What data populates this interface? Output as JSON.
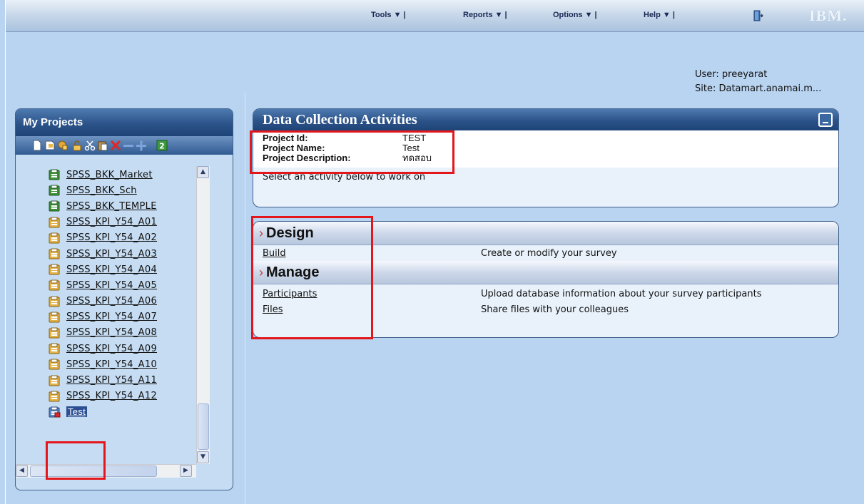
{
  "topbar": {
    "menus": [
      "Tools ▼ |",
      "Reports ▼ |",
      "Options ▼ |",
      "Help ▼ |"
    ],
    "brand": "IBM."
  },
  "user": {
    "user_line": "User: preeyarat",
    "site_line": "Site: Datamart.anamai.m..."
  },
  "projects": {
    "title": "My Projects",
    "toolbar_icons": [
      "new-icon",
      "properties-icon",
      "lock-icon",
      "unlock-icon",
      "cut-icon",
      "paste-icon",
      "delete-icon",
      "collapse-icon",
      "expand-icon",
      "refresh-icon"
    ],
    "items": [
      {
        "label": "SPSS_BKK_Market",
        "icon": "green"
      },
      {
        "label": "SPSS_BKK_Sch",
        "icon": "green"
      },
      {
        "label": "SPSS_BKK_TEMPLE",
        "icon": "green"
      },
      {
        "label": "SPSS_KPI_Y54_A01",
        "icon": "yellow"
      },
      {
        "label": "SPSS_KPI_Y54_A02",
        "icon": "yellow"
      },
      {
        "label": "SPSS_KPI_Y54_A03",
        "icon": "yellow"
      },
      {
        "label": "SPSS_KPI_Y54_A04",
        "icon": "yellow"
      },
      {
        "label": "SPSS_KPI_Y54_A05",
        "icon": "yellow"
      },
      {
        "label": "SPSS_KPI_Y54_A06",
        "icon": "yellow"
      },
      {
        "label": "SPSS_KPI_Y54_A07",
        "icon": "yellow"
      },
      {
        "label": "SPSS_KPI_Y54_A08",
        "icon": "yellow"
      },
      {
        "label": "SPSS_KPI_Y54_A09",
        "icon": "yellow"
      },
      {
        "label": "SPSS_KPI_Y54_A10",
        "icon": "yellow"
      },
      {
        "label": "SPSS_KPI_Y54_A11",
        "icon": "yellow"
      },
      {
        "label": "SPSS_KPI_Y54_A12",
        "icon": "yellow"
      },
      {
        "label": "Test",
        "icon": "locked",
        "selected": true
      }
    ]
  },
  "activities": {
    "title": "Data Collection Activities",
    "project_id_label": "Project Id:",
    "project_id": "TEST",
    "project_name_label": "Project Name:",
    "project_name": "Test",
    "project_desc_label": "Project Description:",
    "project_desc": "ทดสอบ",
    "hint": "Select an activity below to work on"
  },
  "sections": {
    "design_title": "Design",
    "build_link": "Build",
    "build_desc": "Create or modify your survey",
    "manage_title": "Manage",
    "participants_link": "Participants",
    "participants_desc": "Upload database information about your survey participants",
    "files_link": "Files",
    "files_desc": "Share files with your colleagues"
  },
  "colors": {
    "background": "#b9d4f1",
    "title_bar": "#2c5389",
    "highlight_box": "#e3161c",
    "selection": "#2c4f93"
  }
}
